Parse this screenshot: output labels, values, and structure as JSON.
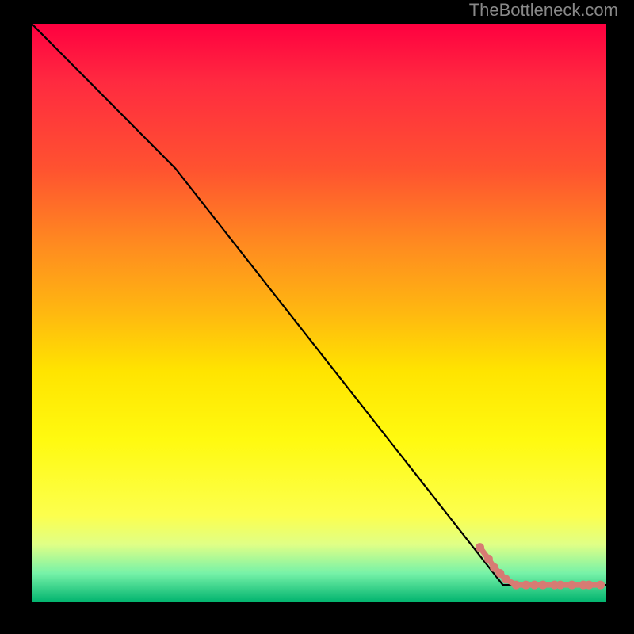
{
  "attribution": "TheBottleneck.com",
  "colors": {
    "gradient_top": "#ff0040",
    "gradient_bottom": "#00b36e",
    "curve": "#000000",
    "dot": "#d77b73",
    "background": "#000000"
  },
  "chart_data": {
    "type": "line",
    "title": "",
    "xlabel": "",
    "ylabel": "",
    "xlim": [
      0,
      100
    ],
    "ylim": [
      0,
      100
    ],
    "series": [
      {
        "name": "curve",
        "x": [
          0,
          25,
          82,
          100
        ],
        "y": [
          100,
          75,
          3,
          3
        ]
      }
    ],
    "dots": {
      "name": "data-points",
      "points": [
        {
          "x": 78,
          "y": 9.5
        },
        {
          "x": 79.5,
          "y": 7.5
        },
        {
          "x": 80.5,
          "y": 6
        },
        {
          "x": 81.5,
          "y": 5
        },
        {
          "x": 82.5,
          "y": 4
        },
        {
          "x": 84.3,
          "y": 3
        },
        {
          "x": 86,
          "y": 3
        },
        {
          "x": 87.5,
          "y": 3
        },
        {
          "x": 89,
          "y": 3
        },
        {
          "x": 91,
          "y": 3
        },
        {
          "x": 92,
          "y": 3
        },
        {
          "x": 94,
          "y": 3
        },
        {
          "x": 96,
          "y": 3
        },
        {
          "x": 97,
          "y": 3
        },
        {
          "x": 99,
          "y": 3
        }
      ]
    }
  }
}
